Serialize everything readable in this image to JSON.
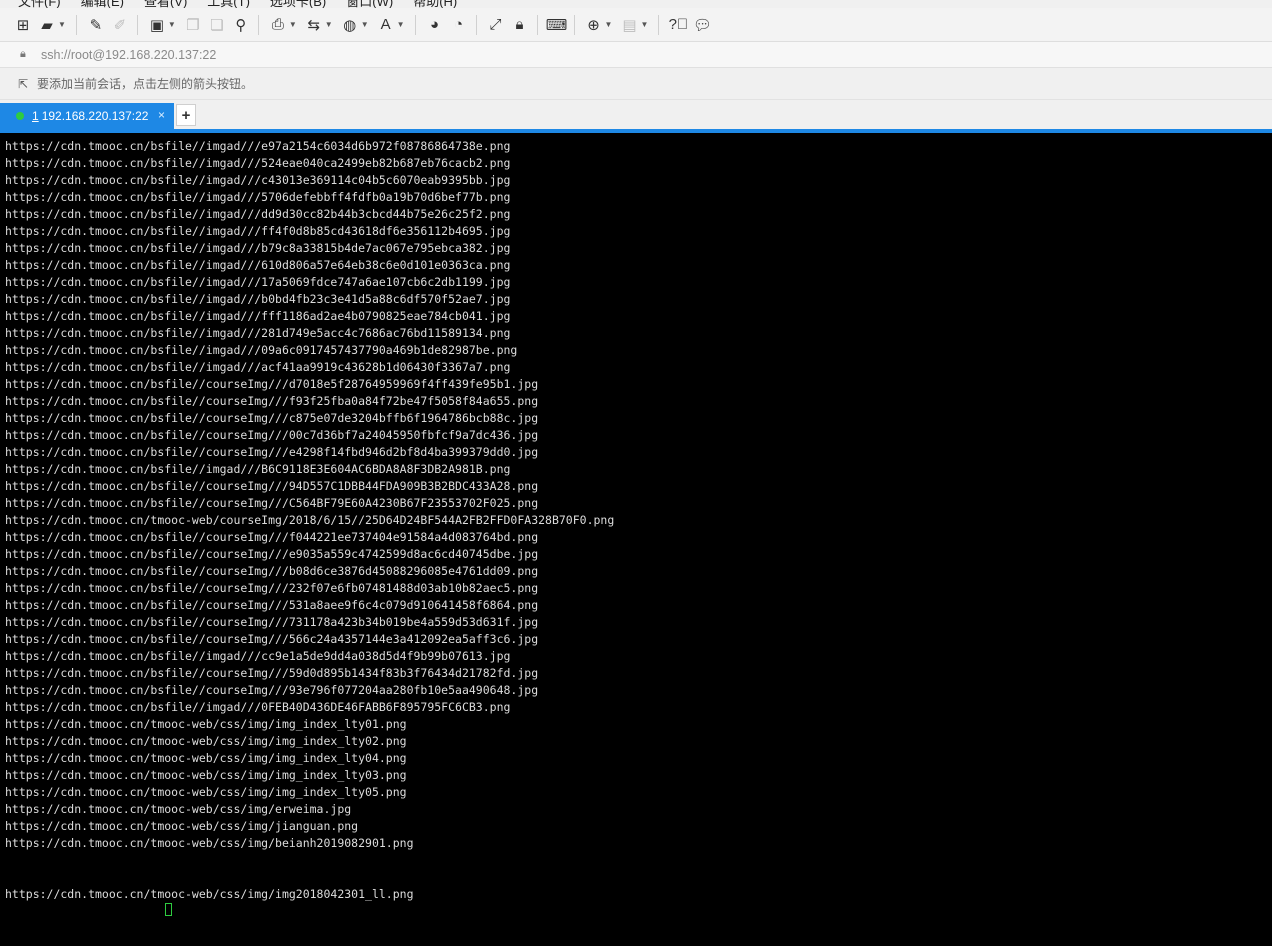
{
  "menu": [
    "文件(F)",
    "编辑(E)",
    "查看(V)",
    "工具(T)",
    "选项卡(B)",
    "窗口(W)",
    "帮助(H)"
  ],
  "address": {
    "lock_icon": "lock-icon",
    "url": "ssh://root@192.168.220.137:22"
  },
  "hint": {
    "icon": "arrow-hint-icon",
    "text": "要添加当前会话，点击左侧的箭头按钮。"
  },
  "tab": {
    "number": "1",
    "title": "192.168.220.137:22",
    "close": "×",
    "status_color": "#2ecc40"
  },
  "newtab_label": "+",
  "colors": {
    "accent": "#1e88e5",
    "terminal_bg": "#000000",
    "terminal_fg": "#dcdcdc",
    "cursor": "#2ecc40"
  },
  "terminal_lines": [
    "https://cdn.tmooc.cn/bsfile//imgad///e97a2154c6034d6b972f08786864738e.png",
    "https://cdn.tmooc.cn/bsfile//imgad///524eae040ca2499eb82b687eb76cacb2.png",
    "https://cdn.tmooc.cn/bsfile//imgad///c43013e369114c04b5c6070eab9395bb.jpg",
    "https://cdn.tmooc.cn/bsfile//imgad///5706defebbff4fdfb0a19b70d6bef77b.png",
    "https://cdn.tmooc.cn/bsfile//imgad///dd9d30cc82b44b3cbcd44b75e26c25f2.png",
    "https://cdn.tmooc.cn/bsfile//imgad///ff4f0d8b85cd43618df6e356112b4695.jpg",
    "https://cdn.tmooc.cn/bsfile//imgad///b79c8a33815b4de7ac067e795ebca382.jpg",
    "https://cdn.tmooc.cn/bsfile//imgad///610d806a57e64eb38c6e0d101e0363ca.png",
    "https://cdn.tmooc.cn/bsfile//imgad///17a5069fdce747a6ae107cb6c2db1199.jpg",
    "https://cdn.tmooc.cn/bsfile//imgad///b0bd4fb23c3e41d5a88c6df570f52ae7.jpg",
    "https://cdn.tmooc.cn/bsfile//imgad///fff1186ad2ae4b0790825eae784cb041.jpg",
    "https://cdn.tmooc.cn/bsfile//imgad///281d749e5acc4c7686ac76bd11589134.png",
    "https://cdn.tmooc.cn/bsfile//imgad///09a6c0917457437790a469b1de82987be.png",
    "https://cdn.tmooc.cn/bsfile//imgad///acf41aa9919c43628b1d06430f3367a7.png",
    "https://cdn.tmooc.cn/bsfile//courseImg///d7018e5f28764959969f4ff439fe95b1.jpg",
    "https://cdn.tmooc.cn/bsfile//courseImg///f93f25fba0a84f72be47f5058f84a655.png",
    "https://cdn.tmooc.cn/bsfile//courseImg///c875e07de3204bffb6f1964786bcb88c.jpg",
    "https://cdn.tmooc.cn/bsfile//courseImg///00c7d36bf7a24045950fbfcf9a7dc436.jpg",
    "https://cdn.tmooc.cn/bsfile//courseImg///e4298f14fbd946d2bf8d4ba399379dd0.jpg",
    "https://cdn.tmooc.cn/bsfile//imgad///B6C9118E3E604AC6BDA8A8F3DB2A981B.png",
    "https://cdn.tmooc.cn/bsfile//courseImg///94D557C1DBB44FDA909B3B2BDC433A28.png",
    "https://cdn.tmooc.cn/bsfile//courseImg///C564BF79E60A4230B67F23553702F025.png",
    "https://cdn.tmooc.cn/tmooc-web/courseImg/2018/6/15//25D64D24BF544A2FB2FFD0FA328B70F0.png",
    "https://cdn.tmooc.cn/bsfile//courseImg///f044221ee737404e91584a4d083764bd.png",
    "https://cdn.tmooc.cn/bsfile//courseImg///e9035a559c4742599d8ac6cd40745dbe.jpg",
    "https://cdn.tmooc.cn/bsfile//courseImg///b08d6ce3876d45088296085e4761dd09.png",
    "https://cdn.tmooc.cn/bsfile//courseImg///232f07e6fb07481488d03ab10b82aec5.png",
    "https://cdn.tmooc.cn/bsfile//courseImg///531a8aee9f6c4c079d910641458f6864.png",
    "https://cdn.tmooc.cn/bsfile//courseImg///731178a423b34b019be4a559d53d631f.jpg",
    "https://cdn.tmooc.cn/bsfile//courseImg///566c24a4357144e3a412092ea5aff3c6.jpg",
    "https://cdn.tmooc.cn/bsfile//imgad///cc9e1a5de9dd4a038d5d4f9b99b07613.jpg",
    "https://cdn.tmooc.cn/bsfile//courseImg///59d0d895b1434f83b3f76434d21782fd.jpg",
    "https://cdn.tmooc.cn/bsfile//courseImg///93e796f077204aa280fb10e5aa490648.jpg",
    "https://cdn.tmooc.cn/bsfile//imgad///0FEB40D436DE46FABB6F895795FC6CB3.png",
    "https://cdn.tmooc.cn/tmooc-web/css/img/img_index_lty01.png",
    "https://cdn.tmooc.cn/tmooc-web/css/img/img_index_lty02.png",
    "https://cdn.tmooc.cn/tmooc-web/css/img/img_index_lty04.png",
    "https://cdn.tmooc.cn/tmooc-web/css/img/img_index_lty03.png",
    "https://cdn.tmooc.cn/tmooc-web/css/img/img_index_lty05.png",
    "https://cdn.tmooc.cn/tmooc-web/css/img/erweima.jpg",
    "https://cdn.tmooc.cn/tmooc-web/css/img/jianguan.png",
    "https://cdn.tmooc.cn/tmooc-web/css/img/beianh2019082901.png",
    "",
    "",
    "https://cdn.tmooc.cn/tmooc-web/css/img/img2018042301_ll.png"
  ]
}
